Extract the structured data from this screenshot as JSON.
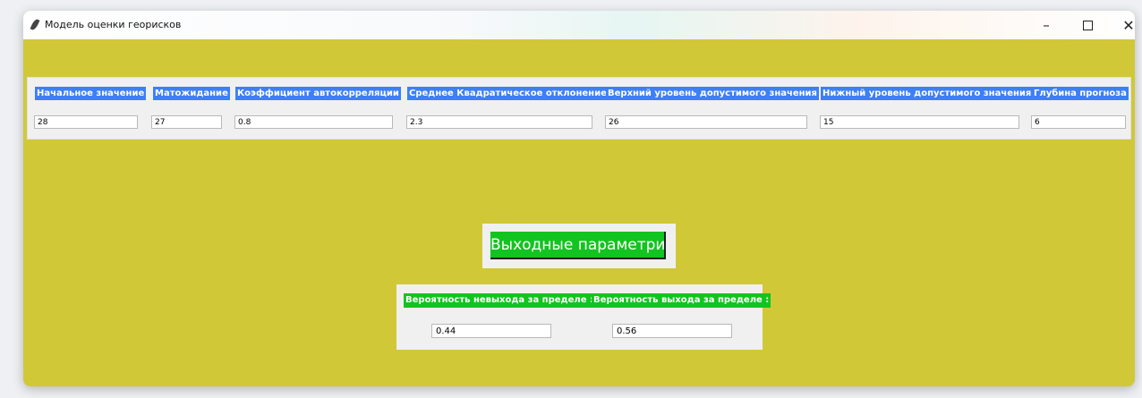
{
  "window": {
    "title": "Модель оценки георисков",
    "controls": {
      "minimize": "–",
      "close": "✕"
    }
  },
  "params": {
    "labels": [
      "Начальное значение",
      "Матожидание",
      "Коэффициент автокорреляции",
      "Среднее Квадратическое отклонение",
      "Верхний уровень допустимого значения",
      "Нижный уровень допустимого значения",
      "Глубина прогноза"
    ],
    "values": [
      "28",
      "27",
      "0.8",
      "2.3",
      "26",
      "15",
      "6"
    ]
  },
  "output_button": {
    "label": "Выходные параметри"
  },
  "results": {
    "labels": [
      "Вероятность невыхода за пределе :",
      "Вероятность выхода за пределе :"
    ],
    "values": [
      "0.44",
      "0.56"
    ]
  },
  "colors": {
    "background": "#d1c838",
    "panel": "#f0f0f0",
    "input_label": "#3d7ff5",
    "button": "#12c41f",
    "result_label": "#12c41f"
  }
}
